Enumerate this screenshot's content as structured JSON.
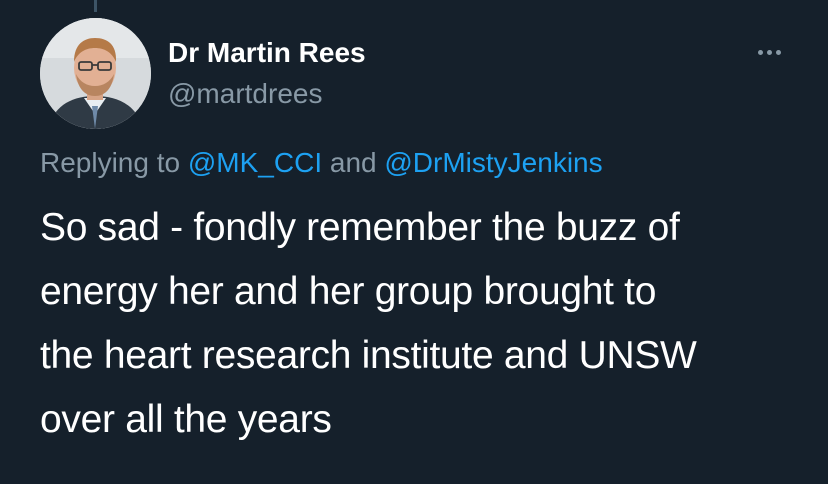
{
  "author": {
    "display_name": "Dr Martin Rees",
    "handle": "@martdrees"
  },
  "reply": {
    "prefix": "Replying to ",
    "mentions": [
      "@MK_CCI",
      "@DrMistyJenkins"
    ],
    "joiner": " and "
  },
  "tweet": {
    "lines": [
      "So sad - fondly remember the buzz of",
      "energy her and her group brought to",
      "the heart research institute and UNSW",
      "over all the years"
    ]
  },
  "icons": {
    "more": "more-horizontal-icon"
  },
  "colors": {
    "background": "#15202b",
    "text_primary": "#ffffff",
    "text_secondary": "#8899a6",
    "link": "#1da1f2"
  }
}
